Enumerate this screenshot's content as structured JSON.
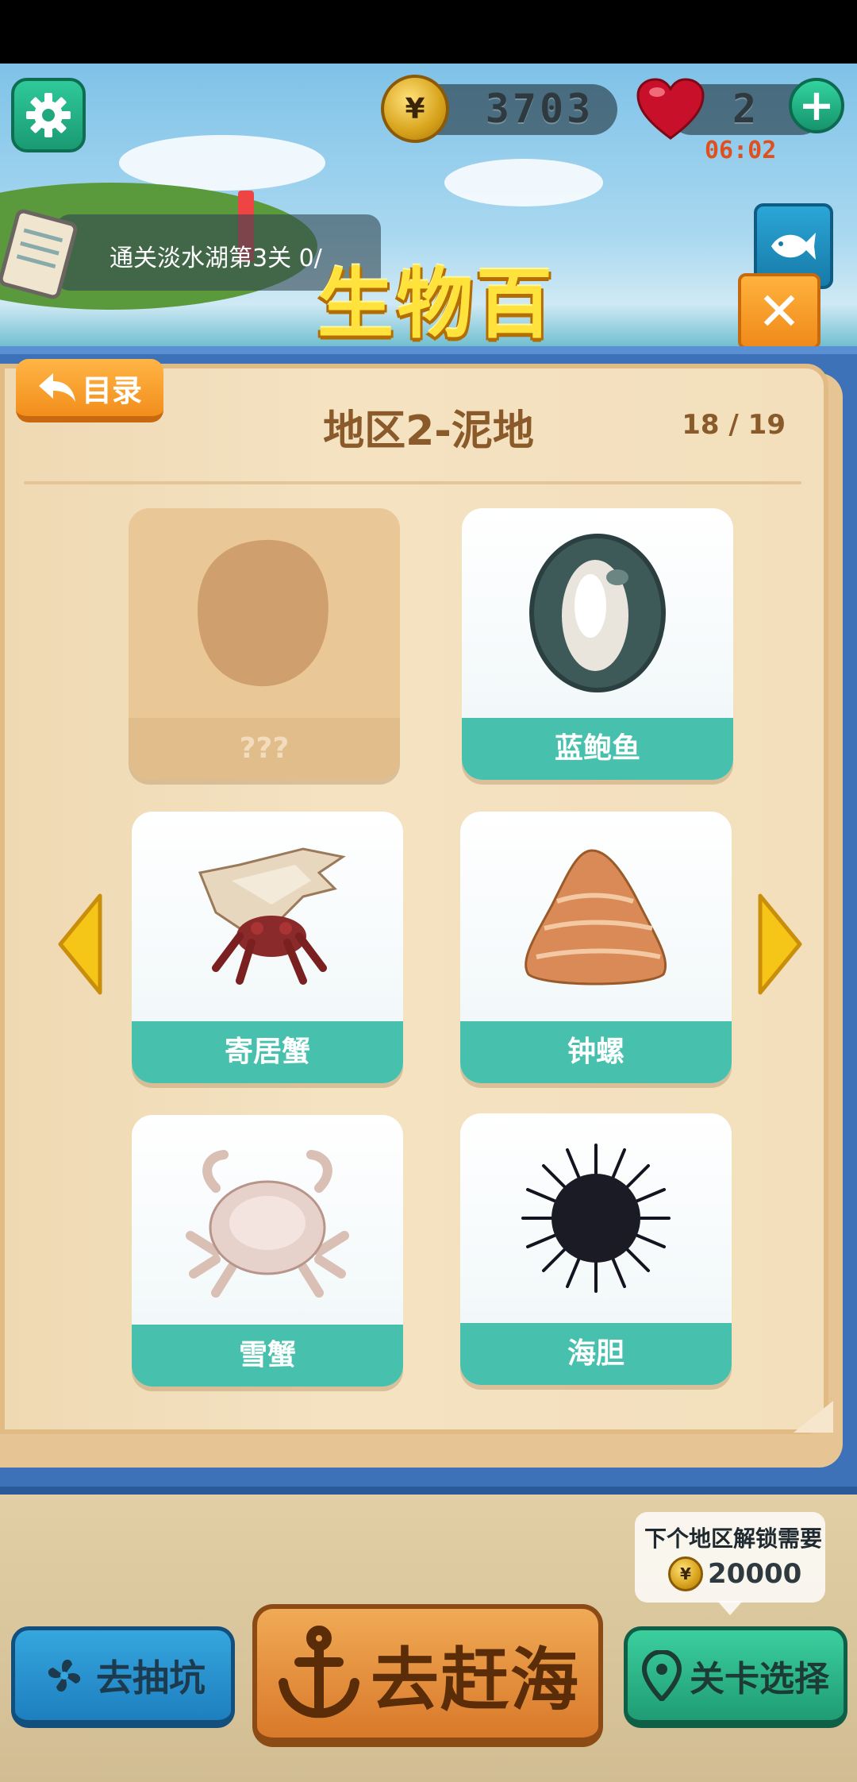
{
  "hud": {
    "coins": "3703",
    "lives": "2",
    "life_timer": "06:02"
  },
  "quest": {
    "text": "通关淡水湖第3关 0/"
  },
  "popup": {
    "title": "生物百科",
    "back_label": "目录",
    "region_title": "地区2-泥地",
    "progress": "18 / 19"
  },
  "creatures": [
    {
      "name": "???",
      "locked": true,
      "icon": "unknown-silhouette-icon"
    },
    {
      "name": "蓝鲍鱼",
      "locked": false,
      "icon": "abalone-icon"
    },
    {
      "name": "寄居蟹",
      "locked": false,
      "icon": "hermit-crab-icon"
    },
    {
      "name": "钟螺",
      "locked": false,
      "icon": "top-snail-icon"
    },
    {
      "name": "雪蟹",
      "locked": false,
      "icon": "snow-crab-icon"
    },
    {
      "name": "海胆",
      "locked": false,
      "icon": "sea-urchin-icon"
    }
  ],
  "unlock_tip": {
    "text": "下个地区解锁需要",
    "cost": "20000"
  },
  "bottom": {
    "left_label": "去抽坑",
    "center_label": "去赶海",
    "right_label": "关卡选择"
  },
  "colors": {
    "teal_label": "#47c1ad",
    "orange_button": "#f28e1c",
    "page_bg": "#f4e2c1",
    "frame_blue": "#3d72b8",
    "title_yellow": "#ffe23b"
  }
}
